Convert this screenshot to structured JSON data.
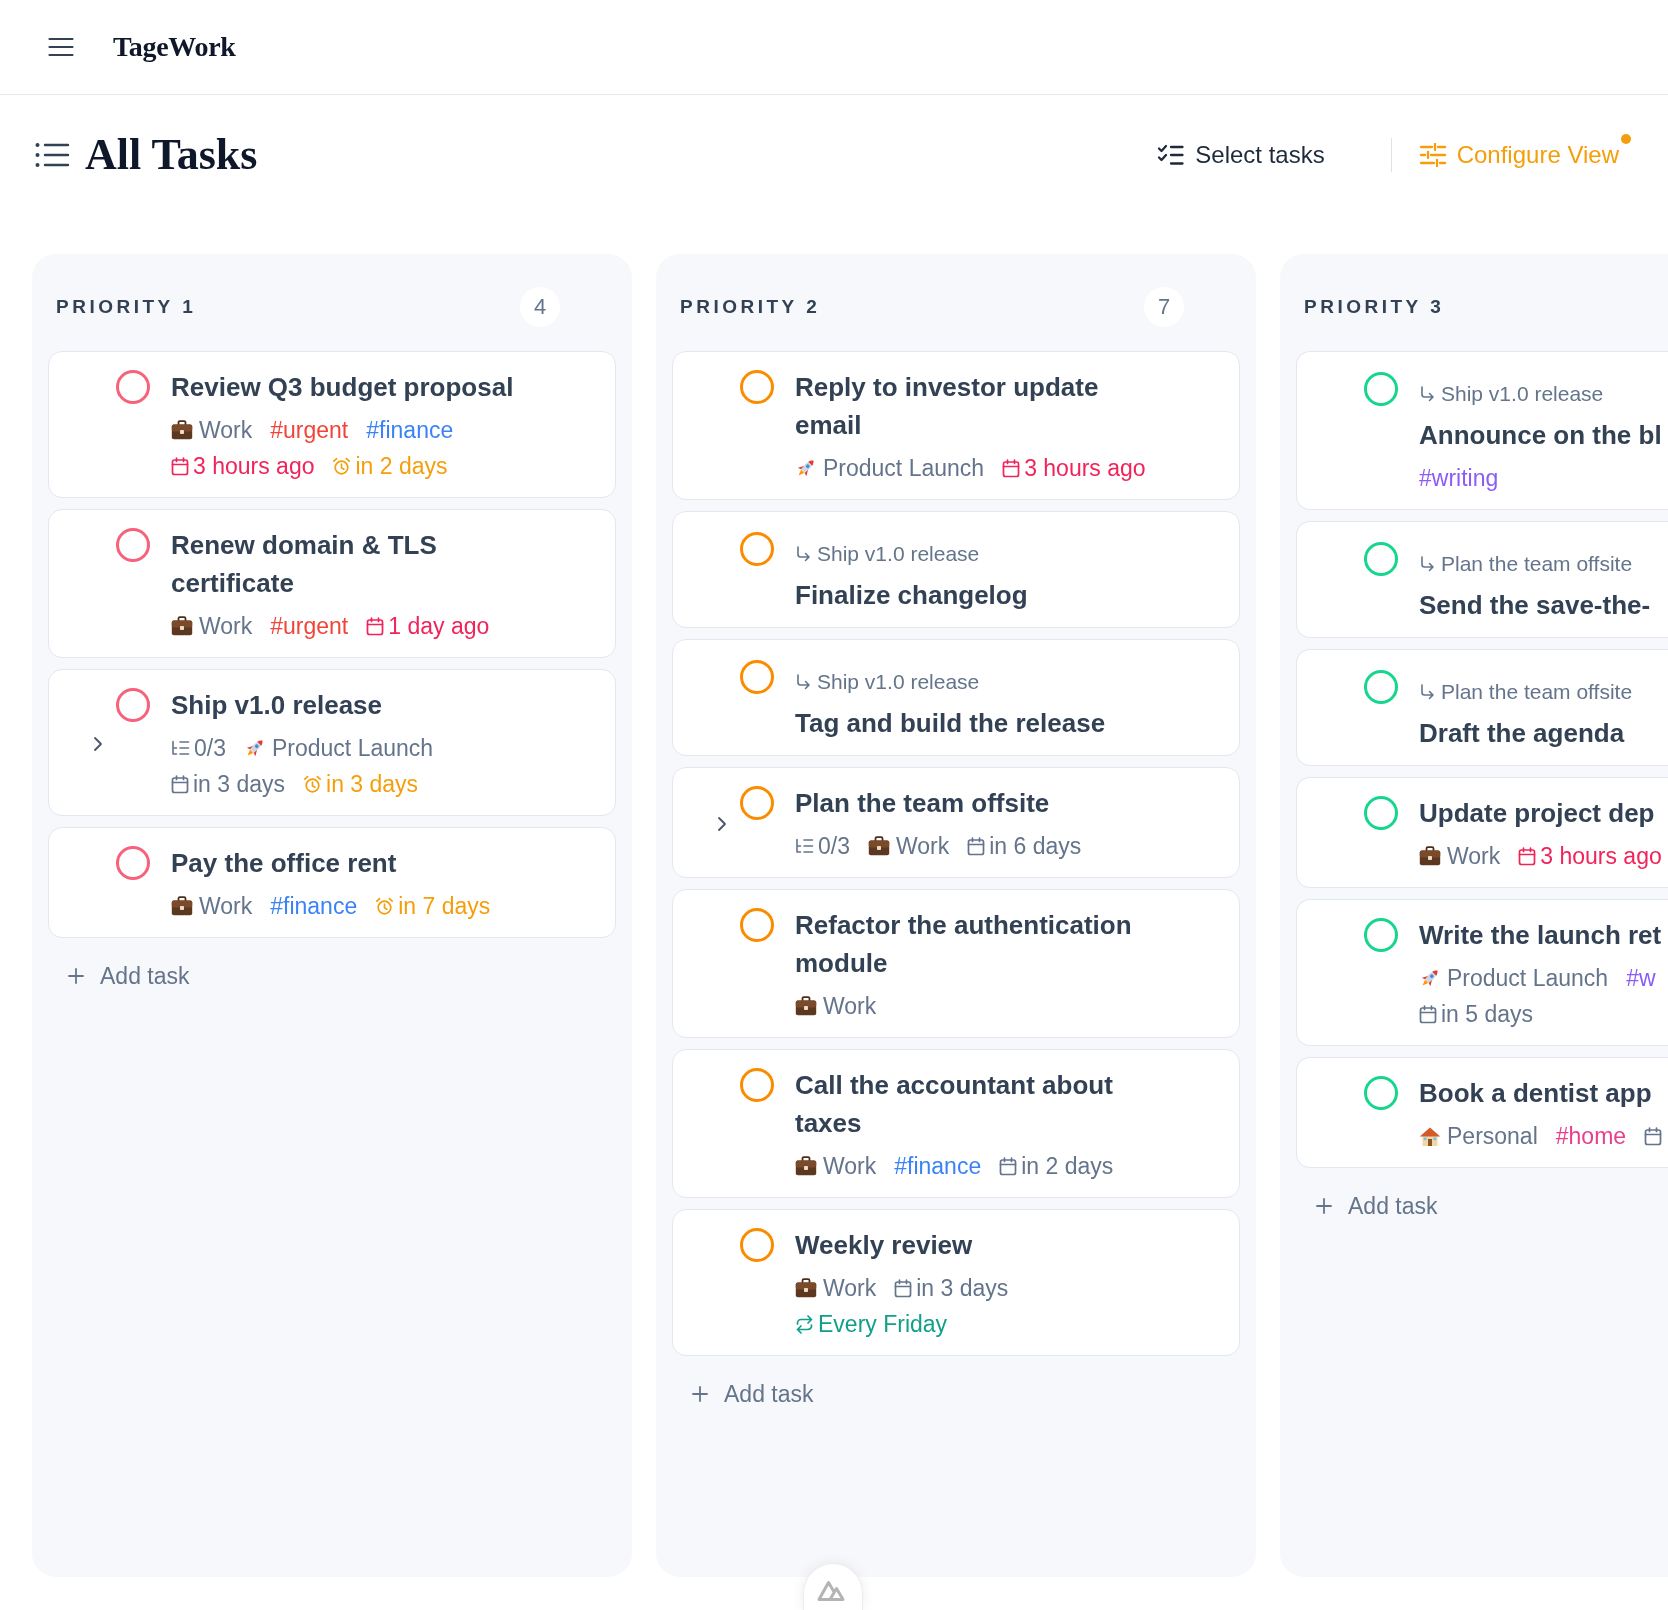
{
  "app_bar": {
    "logo": "TageWork"
  },
  "page": {
    "title": "All Tasks",
    "actions": [
      {
        "kind": "select",
        "label": "Select tasks"
      },
      {
        "kind": "configure",
        "label": "Configure View",
        "indicator": true
      }
    ]
  },
  "columns": [
    {
      "title": "PRIORITY 1",
      "count": "4",
      "color": "#f7627b",
      "add_label": "Add task",
      "tasks": [
        {
          "title": "Review Q3 budget proposal",
          "checked": false,
          "meta_rows": [
            [
              {
                "kind": "briefcase_project",
                "label": "Work"
              },
              {
                "kind": "tag",
                "label": "#urgent",
                "color": "#f04438"
              },
              {
                "kind": "tag",
                "label": "#finance",
                "color": "#3b82f6"
              }
            ],
            [
              {
                "kind": "due",
                "label": "3 hours ago",
                "overdue": true
              },
              {
                "kind": "reminder",
                "label": "in 2 days"
              }
            ]
          ]
        },
        {
          "title": "Renew domain & TLS certificate",
          "checked": false,
          "meta_rows": [
            [
              {
                "kind": "briefcase_project",
                "label": "Work"
              },
              {
                "kind": "tag",
                "label": "#urgent",
                "color": "#f04438"
              },
              {
                "kind": "due",
                "label": "1 day ago",
                "overdue": true
              }
            ]
          ]
        },
        {
          "title": "Ship v1.0 release",
          "checked": false,
          "expanded": false,
          "meta_rows": [
            [
              {
                "kind": "subtasks",
                "label": "0/3"
              },
              {
                "kind": "rocket_project",
                "label": "Product Launch"
              }
            ],
            [
              {
                "kind": "due",
                "label": "in 3 days",
                "overdue": false
              },
              {
                "kind": "reminder",
                "label": "in 3 days"
              }
            ]
          ]
        },
        {
          "title": "Pay the office rent",
          "checked": false,
          "meta_rows": [
            [
              {
                "kind": "briefcase_project",
                "label": "Work"
              },
              {
                "kind": "tag",
                "label": "#finance",
                "color": "#3b82f6"
              },
              {
                "kind": "reminder",
                "label": "in 7 days"
              }
            ]
          ]
        }
      ]
    },
    {
      "title": "PRIORITY 2",
      "count": "7",
      "color": "#fb8c00",
      "add_label": "Add task",
      "tasks": [
        {
          "title": "Reply to investor update email",
          "checked": false,
          "meta_rows": [
            [
              {
                "kind": "rocket_project",
                "label": "Product Launch"
              },
              {
                "kind": "due",
                "label": "3 hours ago",
                "overdue": true
              }
            ]
          ]
        },
        {
          "parent": "Ship v1.0 release",
          "title": "Finalize changelog",
          "checked": false
        },
        {
          "parent": "Ship v1.0 release",
          "title": "Tag and build the release",
          "checked": false
        },
        {
          "title": "Plan the team offsite",
          "checked": false,
          "expanded": false,
          "meta_rows": [
            [
              {
                "kind": "subtasks",
                "label": "0/3"
              },
              {
                "kind": "briefcase_project",
                "label": "Work"
              },
              {
                "kind": "due",
                "label": "in 6 days",
                "overdue": false
              }
            ]
          ]
        },
        {
          "title": "Refactor the authentication module",
          "checked": false,
          "meta_rows": [
            [
              {
                "kind": "briefcase_project",
                "label": "Work"
              }
            ]
          ]
        },
        {
          "title": "Call the accountant about taxes",
          "checked": false,
          "meta_rows": [
            [
              {
                "kind": "briefcase_project",
                "label": "Work"
              },
              {
                "kind": "tag",
                "label": "#finance",
                "color": "#3b82f6"
              },
              {
                "kind": "due",
                "label": "in 2 days",
                "overdue": false
              }
            ]
          ]
        },
        {
          "title": "Weekly review",
          "checked": false,
          "meta_rows": [
            [
              {
                "kind": "briefcase_project",
                "label": "Work"
              },
              {
                "kind": "due",
                "label": "in 3 days",
                "overdue": false
              }
            ],
            [
              {
                "kind": "repeat",
                "label": "Every Friday"
              }
            ]
          ]
        }
      ]
    },
    {
      "title": "PRIORITY 3",
      "color": "#16d68e",
      "add_label": "Add task",
      "tasks": [
        {
          "parent": "Ship v1.0 release",
          "title": "Announce on the bl",
          "checked": false,
          "meta_rows": [
            [
              {
                "kind": "tag",
                "label": "#writing",
                "color": "#8b5cf6"
              }
            ]
          ]
        },
        {
          "parent": "Plan the team offsite",
          "title": "Send the save-the-",
          "checked": false
        },
        {
          "parent": "Plan the team offsite",
          "title": "Draft the agenda",
          "checked": false
        },
        {
          "title": "Update project dep",
          "checked": false,
          "meta_rows": [
            [
              {
                "kind": "briefcase_project",
                "label": "Work"
              },
              {
                "kind": "due",
                "label": "3 hours ago",
                "overdue": true
              }
            ]
          ]
        },
        {
          "title": "Write the launch ret",
          "checked": false,
          "meta_rows": [
            [
              {
                "kind": "rocket_project",
                "label": "Product Launch"
              },
              {
                "kind": "tag",
                "label": "#w",
                "color": "#8b5cf6"
              }
            ],
            [
              {
                "kind": "due",
                "label": "in 5 days",
                "overdue": false
              }
            ]
          ]
        },
        {
          "title": "Book a dentist app",
          "checked": false,
          "meta_rows": [
            [
              {
                "kind": "house_project",
                "label": "Personal"
              },
              {
                "kind": "tag",
                "label": "#home",
                "color": "#e83e8c"
              },
              {
                "kind": "due",
                "overdue": false
              }
            ]
          ]
        }
      ]
    }
  ]
}
